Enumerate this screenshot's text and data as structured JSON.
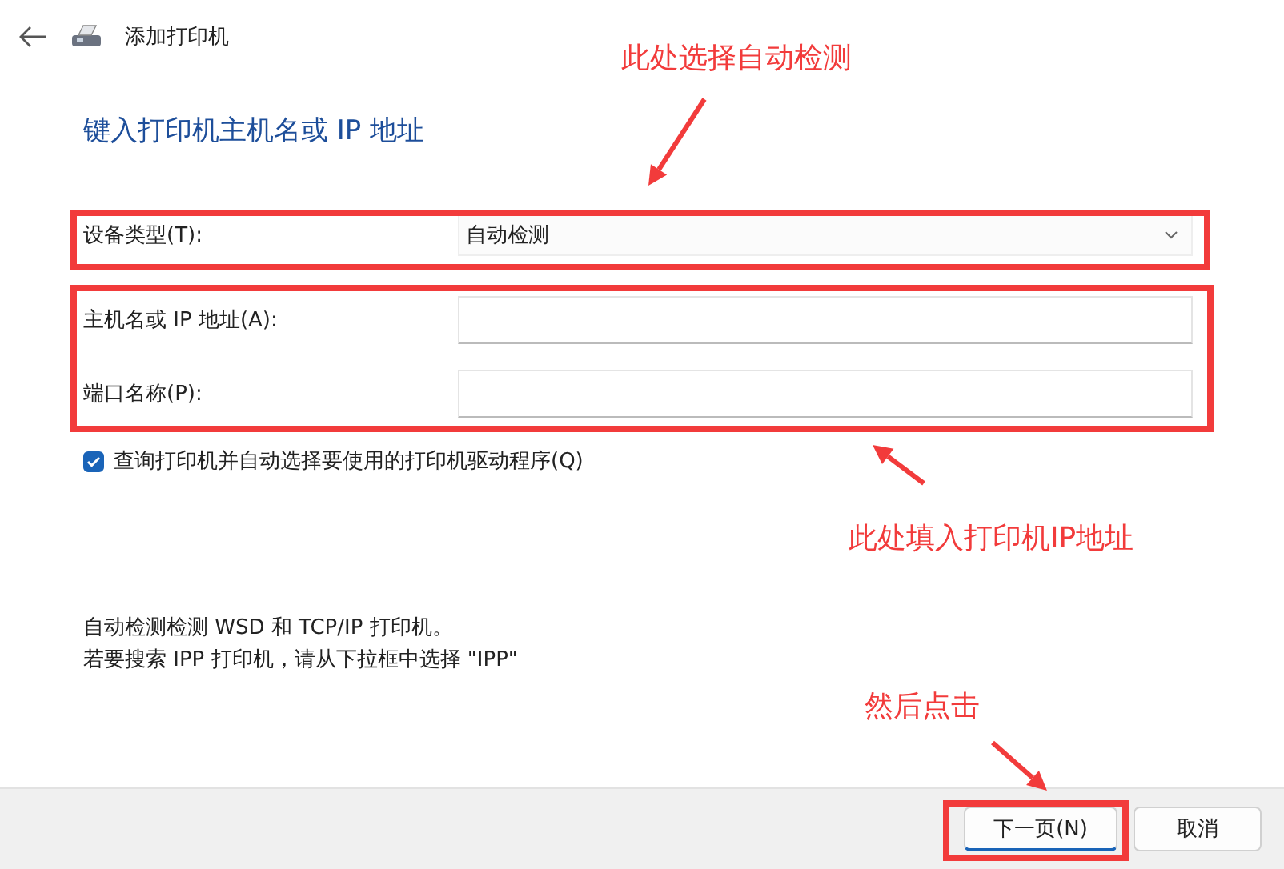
{
  "header": {
    "title": "添加打印机"
  },
  "heading": "键入打印机主机名或 IP 地址",
  "fields": [
    {
      "kind": "select",
      "label": "设备类型(T):",
      "value": "自动检测"
    },
    {
      "kind": "input",
      "label": "主机名或 IP 地址(A):"
    },
    {
      "kind": "input",
      "label": "端口名称(P):"
    }
  ],
  "query_checkbox": {
    "label": "查询打印机并自动选择要使用的打印机驱动程序(Q)",
    "checked": true
  },
  "description": [
    "自动检测检测 WSD 和 TCP/IP 打印机。",
    "若要搜索 IPP 打印机，请从下拉框中选择 \"IPP\""
  ],
  "buttons": [
    {
      "label": "下一页(N)",
      "default": true
    },
    {
      "label": "取消",
      "default": false
    }
  ],
  "annotations": [
    "此处选择自动检测",
    "此处填入打印机IP地址",
    "然后点击"
  ]
}
